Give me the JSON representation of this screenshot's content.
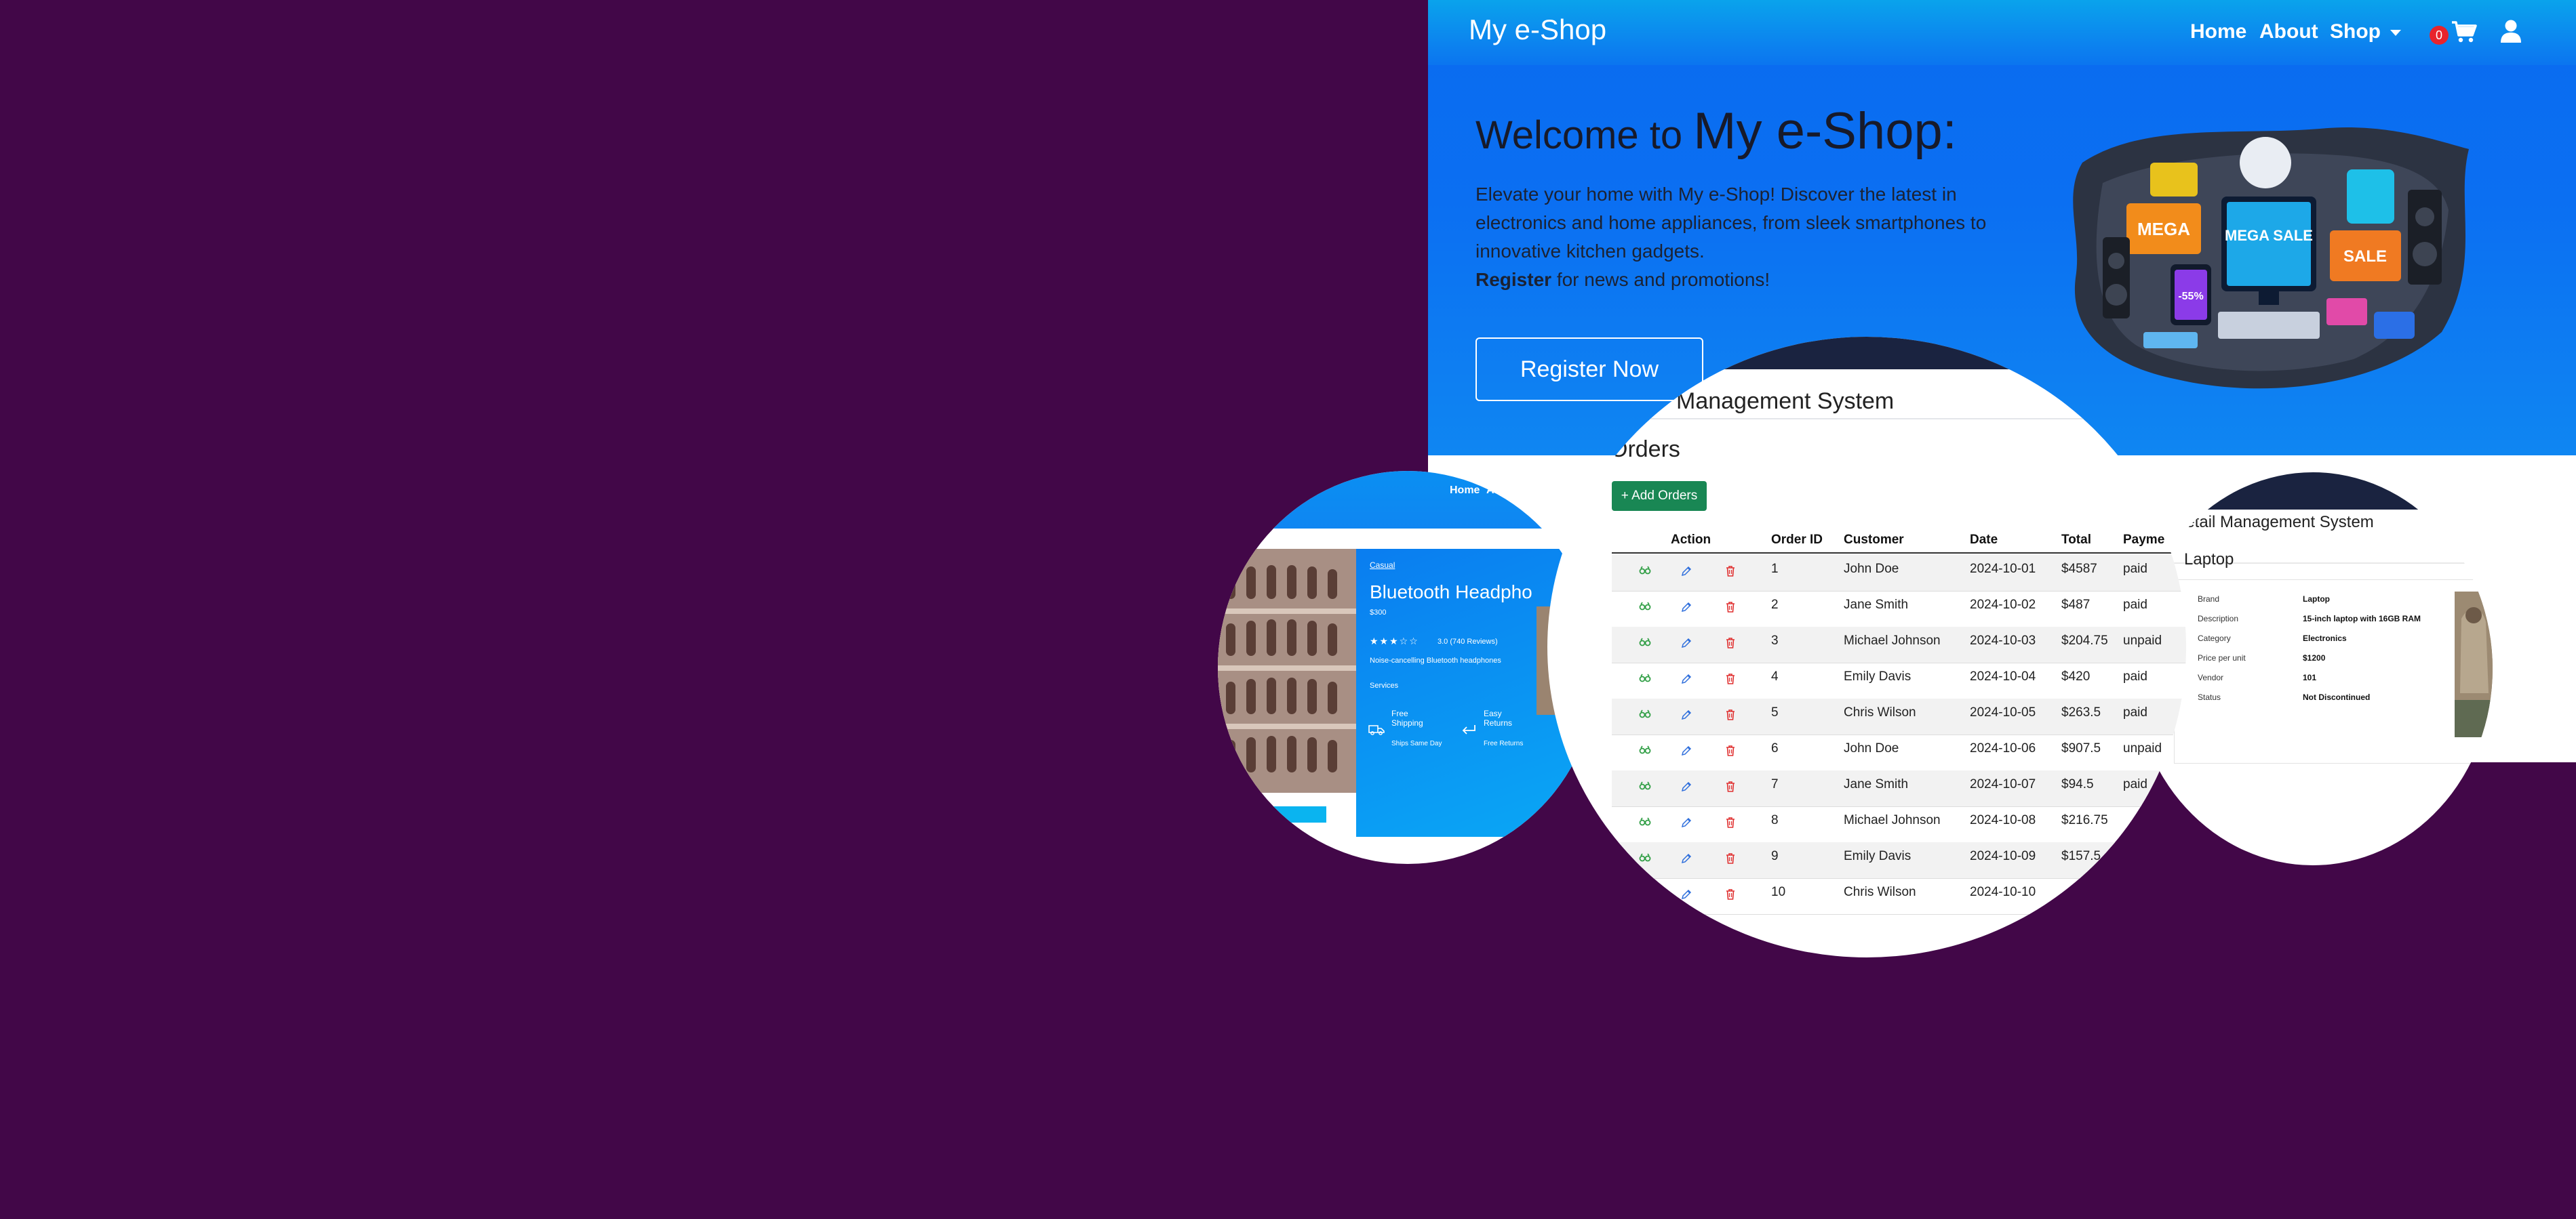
{
  "navbar": {
    "brand": "My e-Shop",
    "links": {
      "home": "Home",
      "about": "About",
      "shop": "Shop"
    },
    "cart_count": "0"
  },
  "hero": {
    "title_prefix": "Welcome to",
    "title_brand": "My e-Shop:",
    "paragraph": "Elevate your home with My e-Shop! Discover the latest in electronics and home appliances, from sleek smartphones to innovative kitchen gadgets.",
    "register_bold": "Register",
    "register_rest": " for news and promotions!",
    "register_button": "Register Now",
    "banner_text_1": "MEGA",
    "banner_text_2": "MEGA SALE",
    "banner_text_3": "SALE",
    "banner_text_4": "-55%"
  },
  "product_page": {
    "nav": {
      "home": "Home",
      "about": "Abo"
    },
    "breadcrumb": "Casual",
    "name": "Bluetooth Headpho",
    "price": "$300",
    "rating": "3.0 (740 Reviews)",
    "description": "Noise-cancelling Bluetooth headphones",
    "services_label": "Services",
    "shipping_title": "Free Shipping",
    "shipping_sub": "Ships Same Day",
    "returns_title": "Easy Returns",
    "returns_sub": "Free Returns"
  },
  "orders_page": {
    "system_title": "Management System",
    "section_title": "Orders",
    "add_button": "+ Add Orders",
    "columns": [
      "Action",
      "Order ID",
      "Customer",
      "Date",
      "Total",
      "Payme"
    ],
    "rows": [
      {
        "id": "1",
        "customer": "John Doe",
        "date": "2024-10-01",
        "total": "$4587",
        "payment": "paid"
      },
      {
        "id": "2",
        "customer": "Jane Smith",
        "date": "2024-10-02",
        "total": "$487",
        "payment": "paid"
      },
      {
        "id": "3",
        "customer": "Michael Johnson",
        "date": "2024-10-03",
        "total": "$204.75",
        "payment": "unpaid"
      },
      {
        "id": "4",
        "customer": "Emily Davis",
        "date": "2024-10-04",
        "total": "$420",
        "payment": "paid"
      },
      {
        "id": "5",
        "customer": "Chris Wilson",
        "date": "2024-10-05",
        "total": "$263.5",
        "payment": "paid"
      },
      {
        "id": "6",
        "customer": "John Doe",
        "date": "2024-10-06",
        "total": "$907.5",
        "payment": "unpaid"
      },
      {
        "id": "7",
        "customer": "Jane Smith",
        "date": "2024-10-07",
        "total": "$94.5",
        "payment": "paid"
      },
      {
        "id": "8",
        "customer": "Michael Johnson",
        "date": "2024-10-08",
        "total": "$216.75",
        "payment": ""
      },
      {
        "id": "9",
        "customer": "Emily Davis",
        "date": "2024-10-09",
        "total": "$157.5",
        "payment": ""
      },
      {
        "id": "10",
        "customer": "Chris Wilson",
        "date": "2024-10-10",
        "total": "",
        "payment": ""
      }
    ]
  },
  "product_detail_page": {
    "system_title": "Retail Management System",
    "section_title": "Laptop",
    "fields": [
      {
        "label": "Brand",
        "value": "Laptop"
      },
      {
        "label": "Description",
        "value": "15-inch laptop with 16GB RAM"
      },
      {
        "label": "Category",
        "value": "Electronics"
      },
      {
        "label": "Price per unit",
        "value": "$1200"
      },
      {
        "label": "Vendor",
        "value": "101"
      },
      {
        "label": "Status",
        "value": "Not Discontinued"
      }
    ]
  },
  "colors": {
    "background": "#420748",
    "hero_blue": "#0a6cf0",
    "add_button_green": "#198754",
    "delete_red": "#e03131",
    "edit_blue": "#2f6fdc",
    "view_green": "#2f9e44"
  }
}
